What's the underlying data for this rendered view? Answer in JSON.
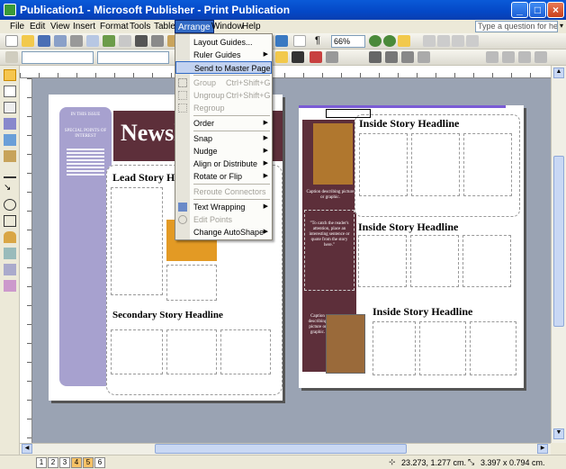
{
  "window": {
    "title": "Publication1 - Microsoft Publisher - Print Publication",
    "min_label": "_",
    "max_label": "□",
    "close_label": "×"
  },
  "menubar": {
    "items": [
      "File",
      "Edit",
      "View",
      "Insert",
      "Format",
      "Tools",
      "Table",
      "Arrange",
      "Window",
      "Help"
    ],
    "help_placeholder": "Type a question for help"
  },
  "toolbar": {
    "zoom": "66%"
  },
  "arrange_menu": {
    "items": [
      {
        "label": "Layout Guides...",
        "disabled": false,
        "submenu": false
      },
      {
        "label": "Ruler Guides",
        "disabled": false,
        "submenu": true
      },
      {
        "label": "Send to Master Page",
        "disabled": false,
        "submenu": false,
        "highlight": true
      },
      {
        "label": "Group",
        "shortcut": "Ctrl+Shift+G",
        "disabled": true,
        "submenu": false
      },
      {
        "label": "Ungroup",
        "shortcut": "Ctrl+Shift+G",
        "disabled": true,
        "submenu": false
      },
      {
        "label": "Regroup",
        "disabled": true,
        "submenu": false
      },
      {
        "label": "Order",
        "disabled": false,
        "submenu": true
      },
      {
        "label": "Snap",
        "disabled": false,
        "submenu": true
      },
      {
        "label": "Nudge",
        "disabled": false,
        "submenu": true
      },
      {
        "label": "Align or Distribute",
        "disabled": false,
        "submenu": true
      },
      {
        "label": "Rotate or Flip",
        "disabled": false,
        "submenu": true
      },
      {
        "label": "Reroute Connectors",
        "disabled": true,
        "submenu": false
      },
      {
        "label": "Text Wrapping",
        "disabled": false,
        "submenu": true
      },
      {
        "label": "Edit Points",
        "disabled": true,
        "submenu": false
      },
      {
        "label": "Change AutoShape",
        "disabled": false,
        "submenu": true
      }
    ]
  },
  "publication": {
    "left_page": {
      "masthead": "Newsle",
      "lead_headline": "Lead Story He",
      "secondary_headline": "Secondary Story Headline",
      "sidebar_heading": "IN THIS ISSUE",
      "sidebar_subheading": "SPECIAL POINTS OF INTEREST"
    },
    "right_page": {
      "headline_top": "Inside Story Headline",
      "headline_mid": "Inside Story Headline",
      "headline_bottom": "Inside Story Headline",
      "caption_top": "Caption describing picture or graphic.",
      "pullquote": "\"To catch the reader's attention, place an interesting sentence or quote from the story here.\"",
      "caption_bottom": "Caption describing picture or graphic."
    }
  },
  "statusbar": {
    "pages": [
      "1",
      "2",
      "3",
      "4",
      "5",
      "6"
    ],
    "current_pages": [
      "4",
      "5"
    ],
    "position": "23.273, 1.277 cm.",
    "size": "3.397 x 0.794 cm."
  },
  "colors": {
    "accent_purple": "#5d2f3a",
    "accent_lavender": "#a7a1cf",
    "menu_highlight": "#316ac5"
  }
}
